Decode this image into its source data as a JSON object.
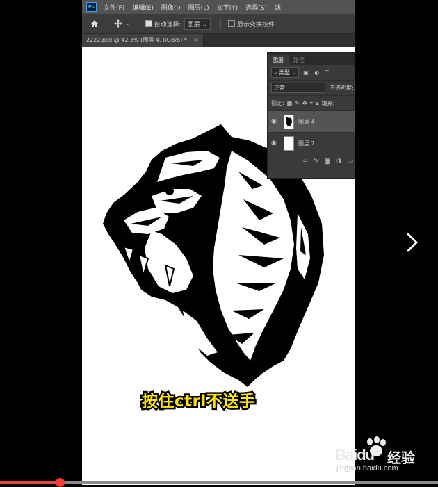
{
  "photoshop": {
    "logo": "Ps",
    "menu": [
      "文件(F)",
      "编辑(E)",
      "图像(I)",
      "图层(L)",
      "文字(Y)",
      "选择(S)",
      "滤"
    ],
    "options": {
      "auto_select_label": "自动选择:",
      "auto_select_value": "图层",
      "show_transform_label": "显示变换控件"
    },
    "document_tab": {
      "title": "2222.psd @ 42.3% (图层 4, RGB/8) *",
      "close": "×"
    },
    "layers_panel": {
      "tabs": [
        "图层",
        "路径"
      ],
      "filter_kind": "类型",
      "blend_mode": "正常",
      "opacity_label": "不透明度:",
      "lock_label": "锁定:",
      "fill_label": "填充:",
      "layers": [
        {
          "name": "图层 4",
          "selected": true
        },
        {
          "name": "图层 2",
          "selected": false
        }
      ]
    }
  },
  "subtitle": "按住ctrl不送手",
  "watermark": {
    "brand": "Baidu",
    "cn": "经验",
    "url": "jingyan.baidu.com"
  },
  "video": {
    "progress_fraction": 0.22,
    "accent": "#f03a35"
  },
  "nav": {
    "next_icon": "chevron-right-icon"
  }
}
